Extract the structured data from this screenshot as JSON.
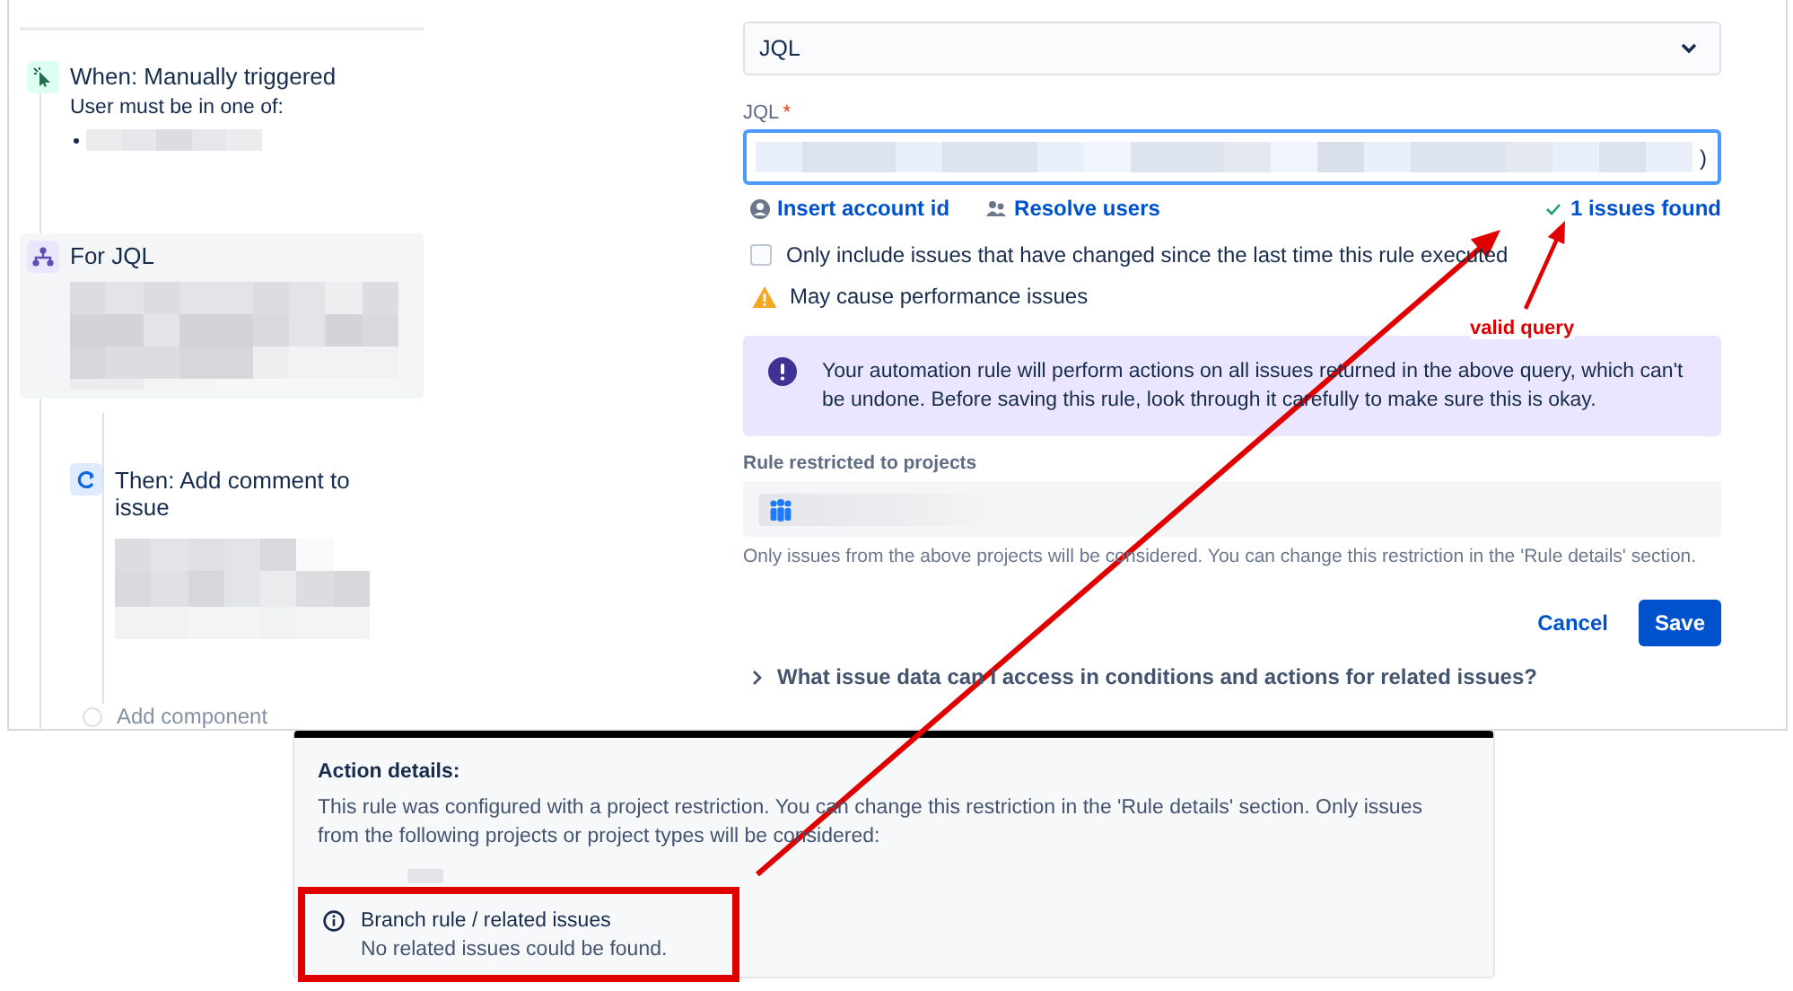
{
  "flow": {
    "trigger": {
      "title": "When: Manually triggered",
      "subtitle": "User must be in one of:"
    },
    "branch": {
      "title": "For JQL",
      "selected": true
    },
    "action": {
      "title": "Then: Add comment to issue"
    },
    "add_component": "Add component"
  },
  "form": {
    "type_select": {
      "value": "JQL"
    },
    "jql": {
      "label": "JQL",
      "required_mark": "*",
      "visible_text": ")"
    },
    "links": [
      {
        "label": "Insert account id",
        "kind": "account"
      },
      {
        "label": "Resolve users",
        "kind": "users"
      }
    ],
    "result": "1 issues found",
    "checkbox": {
      "label": "Only include issues that have changed since the last time this rule executed",
      "checked": false
    },
    "warning": "May cause performance issues",
    "notice": "Your automation rule will perform actions on all issues returned in the above query, which can't be undone. Before saving this rule, look through it carefully to make sure this is okay.",
    "restriction": {
      "label": "Rule restricted to projects",
      "help": "Only issues from the above projects will be considered. You can change this restriction in the 'Rule details' section."
    },
    "buttons": [
      {
        "label": "Cancel",
        "kind": "link"
      },
      {
        "label": "Save",
        "kind": "primary"
      }
    ],
    "expander": {
      "label": "What issue data can I access in conditions and actions for related issues?",
      "expanded": false
    }
  },
  "details": {
    "title": "Action details:",
    "text": "This rule was configured with a project restriction. You can change this restriction in the 'Rule details' section. Only issues from the following projects or project types will be considered:",
    "message": {
      "title": "Branch rule / related issues",
      "text": "No related issues could be found."
    }
  },
  "annotation": {
    "label": "valid query"
  }
}
